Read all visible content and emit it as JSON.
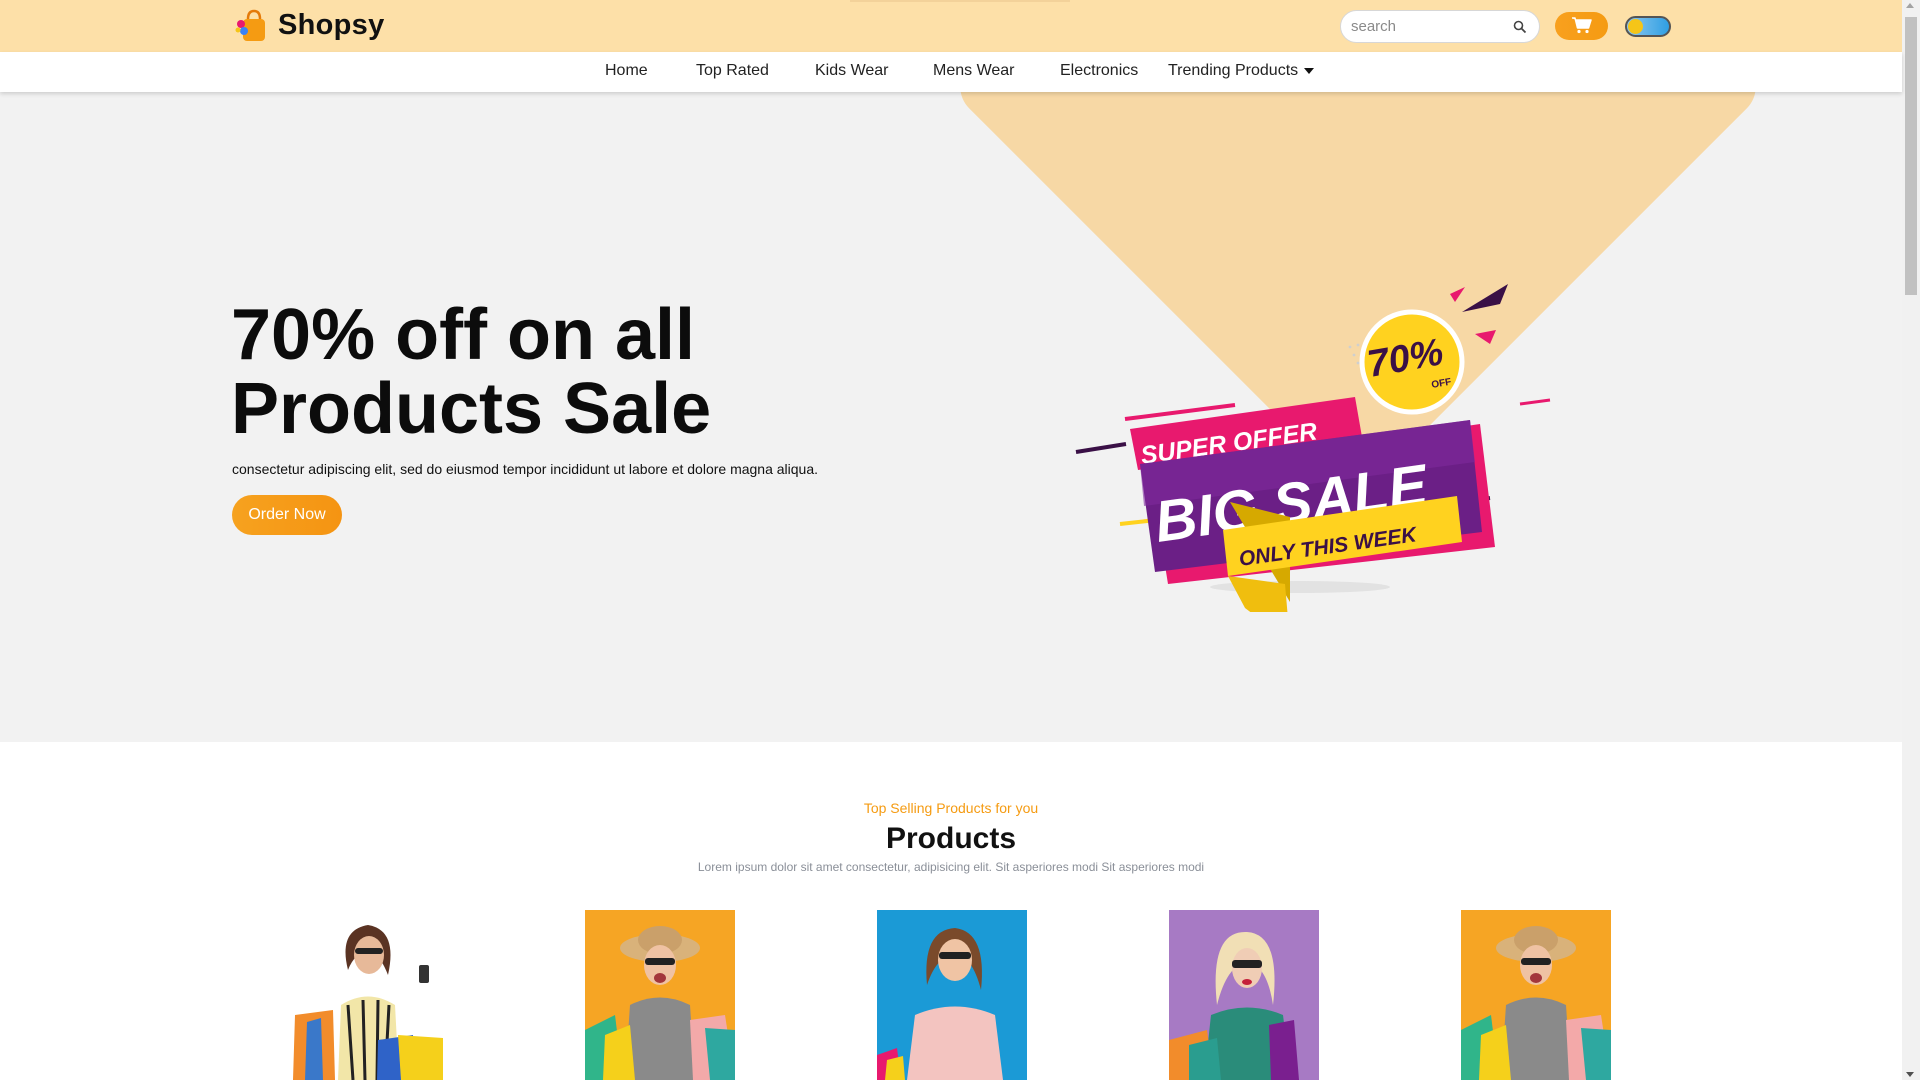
{
  "brand": {
    "name": "Shopsy",
    "logo_icon": "shopping-bag-icon"
  },
  "search": {
    "placeholder": "search",
    "icon": "search-icon"
  },
  "header": {
    "cart_icon": "cart-icon",
    "theme_toggle_icon": "theme-toggle"
  },
  "nav": {
    "items": [
      {
        "label": "Home"
      },
      {
        "label": "Top Rated"
      },
      {
        "label": "Kids Wear"
      },
      {
        "label": "Mens Wear"
      },
      {
        "label": "Electronics"
      },
      {
        "label": "Trending Products"
      }
    ],
    "dropdown_icon": "caret-down-icon"
  },
  "hero": {
    "headline_line1": "70% off on all",
    "headline_line2": "Products Sale",
    "subtitle": "consectetur adipiscing elit, sed do eiusmod tempor incididunt ut labore et dolore magna aliqua.",
    "cta": "Order Now",
    "banner": {
      "badge": "70%",
      "badge_small": "OFF",
      "super_offer": "SUPER OFFER",
      "big_sale": "BIG SALE",
      "only_week": "ONLY THIS WEEK"
    }
  },
  "products": {
    "kicker": "Top Selling Products for you",
    "title": "Products",
    "subtitle": "Lorem ipsum dolor sit amet consectetur, adipisicing elit. Sit asperiores modi Sit asperiores modi"
  },
  "colors": {
    "accent": "#f59b12",
    "header_bg": "#fde0a8",
    "hero_bg": "#f2f2f2",
    "hero_shape": "#f7d8a5",
    "sale_purple": "#5a1a7a",
    "sale_pink": "#e8196e",
    "sale_yellow": "#ffd21f"
  }
}
